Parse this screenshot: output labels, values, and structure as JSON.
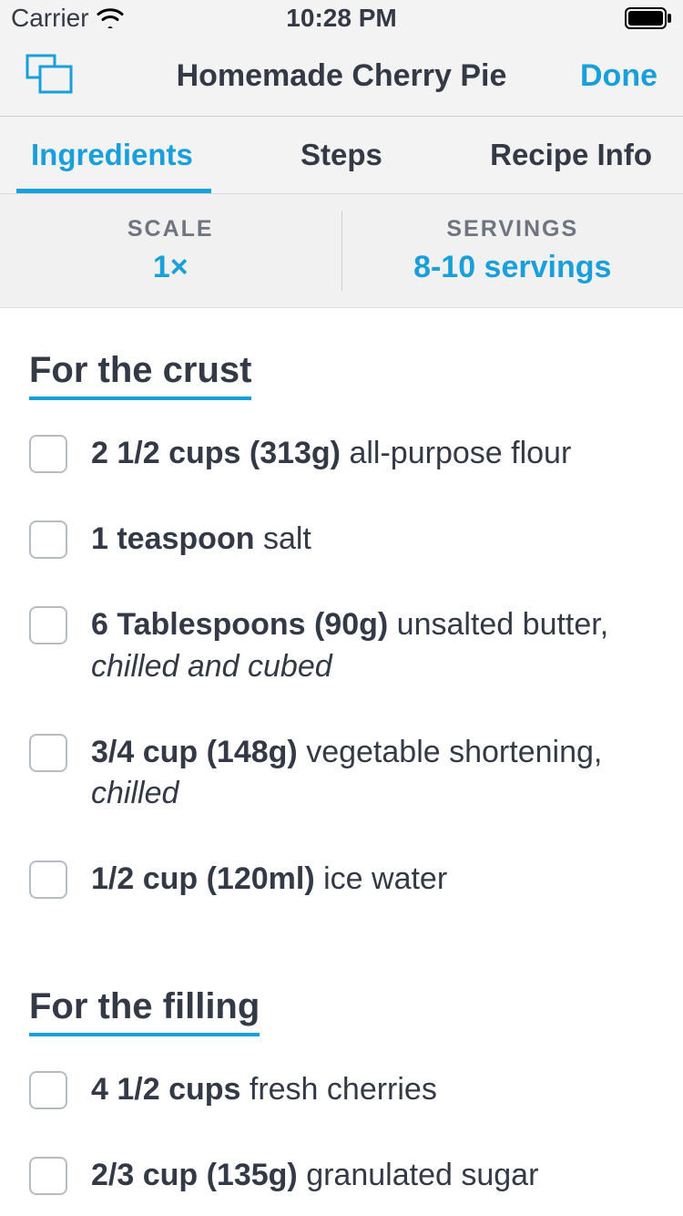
{
  "status": {
    "carrier": "Carrier",
    "time": "10:28 PM"
  },
  "nav": {
    "title": "Homemade Cherry Pie",
    "done": "Done"
  },
  "tabs": {
    "ingredients": "Ingredients",
    "steps": "Steps",
    "info": "Recipe Info"
  },
  "scale": {
    "scale_label": "SCALE",
    "scale_value": "1×",
    "servings_label": "SERVINGS",
    "servings_value": "8-10 servings"
  },
  "sections": [
    {
      "title": "For the crust",
      "items": [
        {
          "amount": "2 1/2 cups (313g)",
          "name": "all-purpose flour",
          "note": ""
        },
        {
          "amount": "1 teaspoon",
          "name": "salt",
          "note": ""
        },
        {
          "amount": "6 Tablespoons (90g)",
          "name": "unsalted butter,",
          "note": "chilled and cubed"
        },
        {
          "amount": "3/4 cup (148g)",
          "name": "vegetable shortening,",
          "note": "chilled"
        },
        {
          "amount": "1/2 cup (120ml)",
          "name": "ice water",
          "note": ""
        }
      ]
    },
    {
      "title": "For the filling",
      "items": [
        {
          "amount": "4 1/2 cups",
          "name": "fresh cherries",
          "note": ""
        },
        {
          "amount": "2/3 cup (135g)",
          "name": "granulated sugar",
          "note": ""
        }
      ]
    }
  ]
}
